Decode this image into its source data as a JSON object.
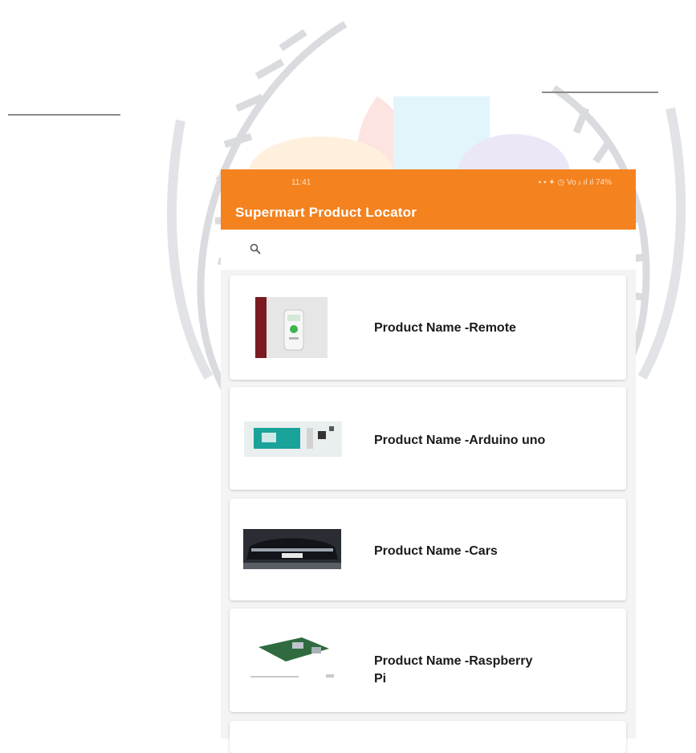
{
  "status_bar": {
    "time": "11:41",
    "indicators": "▪ ▪ ✦ ◷ Vo ᵢₗ ıl ıl 74%"
  },
  "app_bar": {
    "title": "Supermart Product Locator"
  },
  "search": {
    "icon": "search-icon",
    "placeholder": ""
  },
  "products": [
    {
      "label": "Product Name -Remote",
      "image": "remote"
    },
    {
      "label": "Product Name -Arduino uno",
      "image": "arduino-board"
    },
    {
      "label": "Product Name -Cars",
      "image": "car"
    },
    {
      "label": "Product Name -Raspberry Pi",
      "image": "raspberry-pi-board"
    }
  ],
  "colors": {
    "accent": "#f4821f",
    "card": "#ffffff",
    "background": "#f4f4f4"
  }
}
